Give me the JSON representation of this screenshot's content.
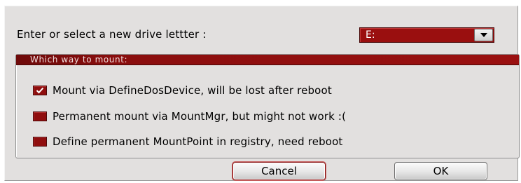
{
  "dialog": {
    "prompt": "Enter or select a new drive lettter :",
    "drive_select": {
      "value": "E:",
      "dropdown_icon": "chevron-down-icon"
    },
    "group": {
      "title": "Which way to mount:",
      "options": [
        {
          "label": "Mount via DefineDosDevice, will be lost after reboot",
          "checked": true
        },
        {
          "label": "Permanent mount via MountMgr, but might not work :(",
          "checked": false
        },
        {
          "label": "Define permanent MountPoint in registry, need reboot",
          "checked": false
        }
      ]
    },
    "buttons": {
      "cancel": "Cancel",
      "ok": "OK"
    }
  },
  "colors": {
    "accent": "#9a0f0f",
    "dialog_bg": "#e2e0df"
  }
}
